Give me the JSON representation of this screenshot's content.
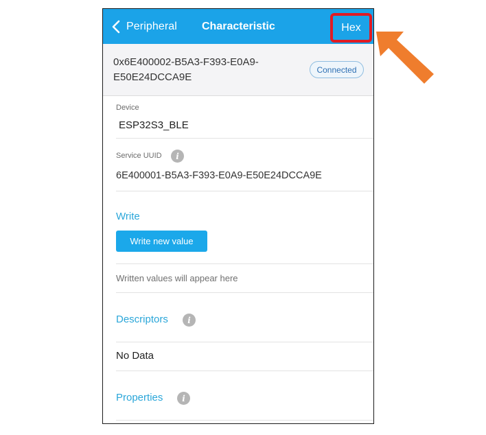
{
  "nav": {
    "back_label": "Peripheral",
    "title": "Characteristic",
    "hex_label": "Hex"
  },
  "header": {
    "uuid_line1": "0x6E400002-B5A3-F393-E0A9-",
    "uuid_line2": "E50E24DCCA9E",
    "status": "Connected"
  },
  "device": {
    "label": "Device",
    "value": "ESP32S3_BLE"
  },
  "service": {
    "label": "Service UUID",
    "value": "6E400001-B5A3-F393-E0A9-E50E24DCCA9E"
  },
  "write": {
    "title": "Write",
    "button_label": "Write new value",
    "placeholder": "Written values will appear here"
  },
  "descriptors": {
    "title": "Descriptors",
    "value": "No Data"
  },
  "properties": {
    "title": "Properties"
  },
  "colors": {
    "accent": "#1ba3e8",
    "highlight": "#e01b24",
    "arrow": "#ef7d2d"
  }
}
